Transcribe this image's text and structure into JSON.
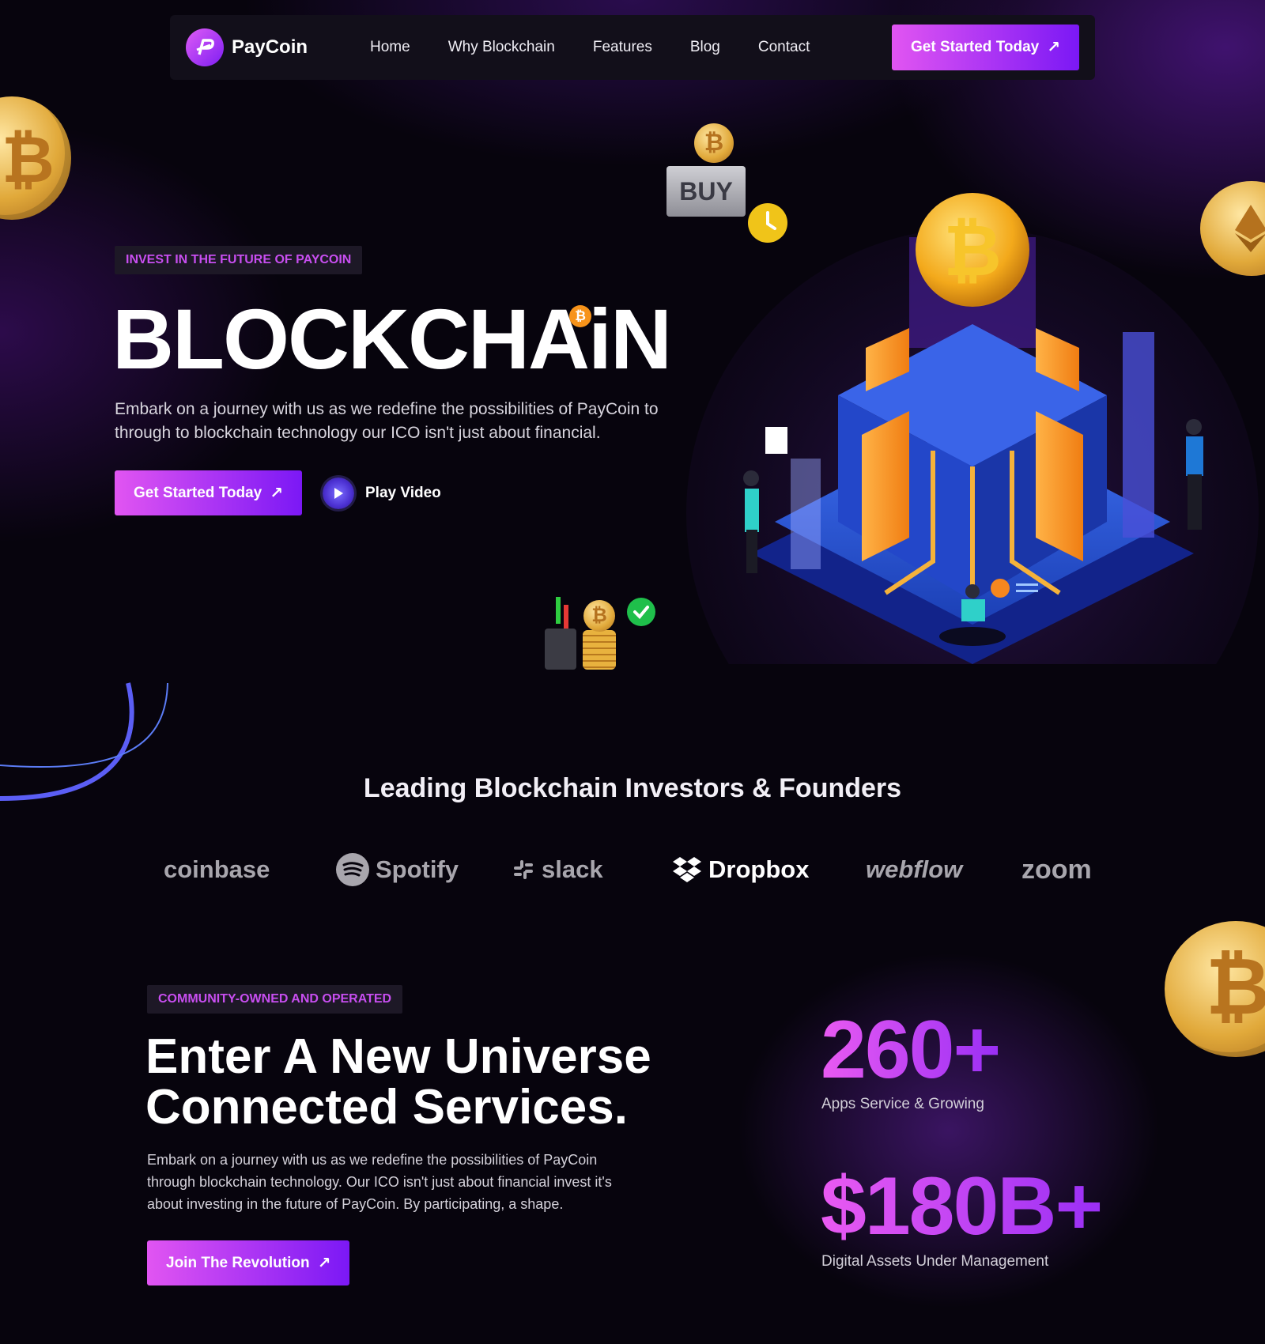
{
  "nav": {
    "brand": "PayCoin",
    "links": [
      "Home",
      "Why Blockchain",
      "Features",
      "Blog",
      "Contact"
    ],
    "cta": "Get Started Today"
  },
  "hero": {
    "tag": "INVEST IN THE FUTURE OF PAYCOIN",
    "title": "BLOCKCHAiN",
    "description": "Embark on a journey with us as we redefine the possibilities of PayCoin to through to blockchain technology our ICO isn't just about financial.",
    "cta": "Get Started Today",
    "play_label": "Play Video",
    "illustration_buy_label": "BUY",
    "btc_symbol": "₿"
  },
  "investors": {
    "title": "Leading Blockchain Investors & Founders",
    "brands": [
      "coinbase",
      "Spotify",
      "slack",
      "Dropbox",
      "webflow",
      "zoom"
    ]
  },
  "community": {
    "tag": "COMMUNITY-OWNED AND OPERATED",
    "title_line1": "Enter A New Universe",
    "title_line2": "Connected Services.",
    "description": "Embark on a journey with us as we redefine the possibilities of PayCoin through blockchain technology. Our ICO isn't just about financial invest it's about investing in the future of PayCoin. By participating, a shape.",
    "cta": "Join The Revolution",
    "stats": [
      {
        "value": "260+",
        "label": "Apps Service & Growing"
      },
      {
        "value": "$180B+",
        "label": "Digital Assets Under Management"
      }
    ]
  },
  "colors": {
    "accent_start": "#e155f2",
    "accent_end": "#7b18f5",
    "background": "#07040d",
    "tag_text": "#c84ef0"
  }
}
